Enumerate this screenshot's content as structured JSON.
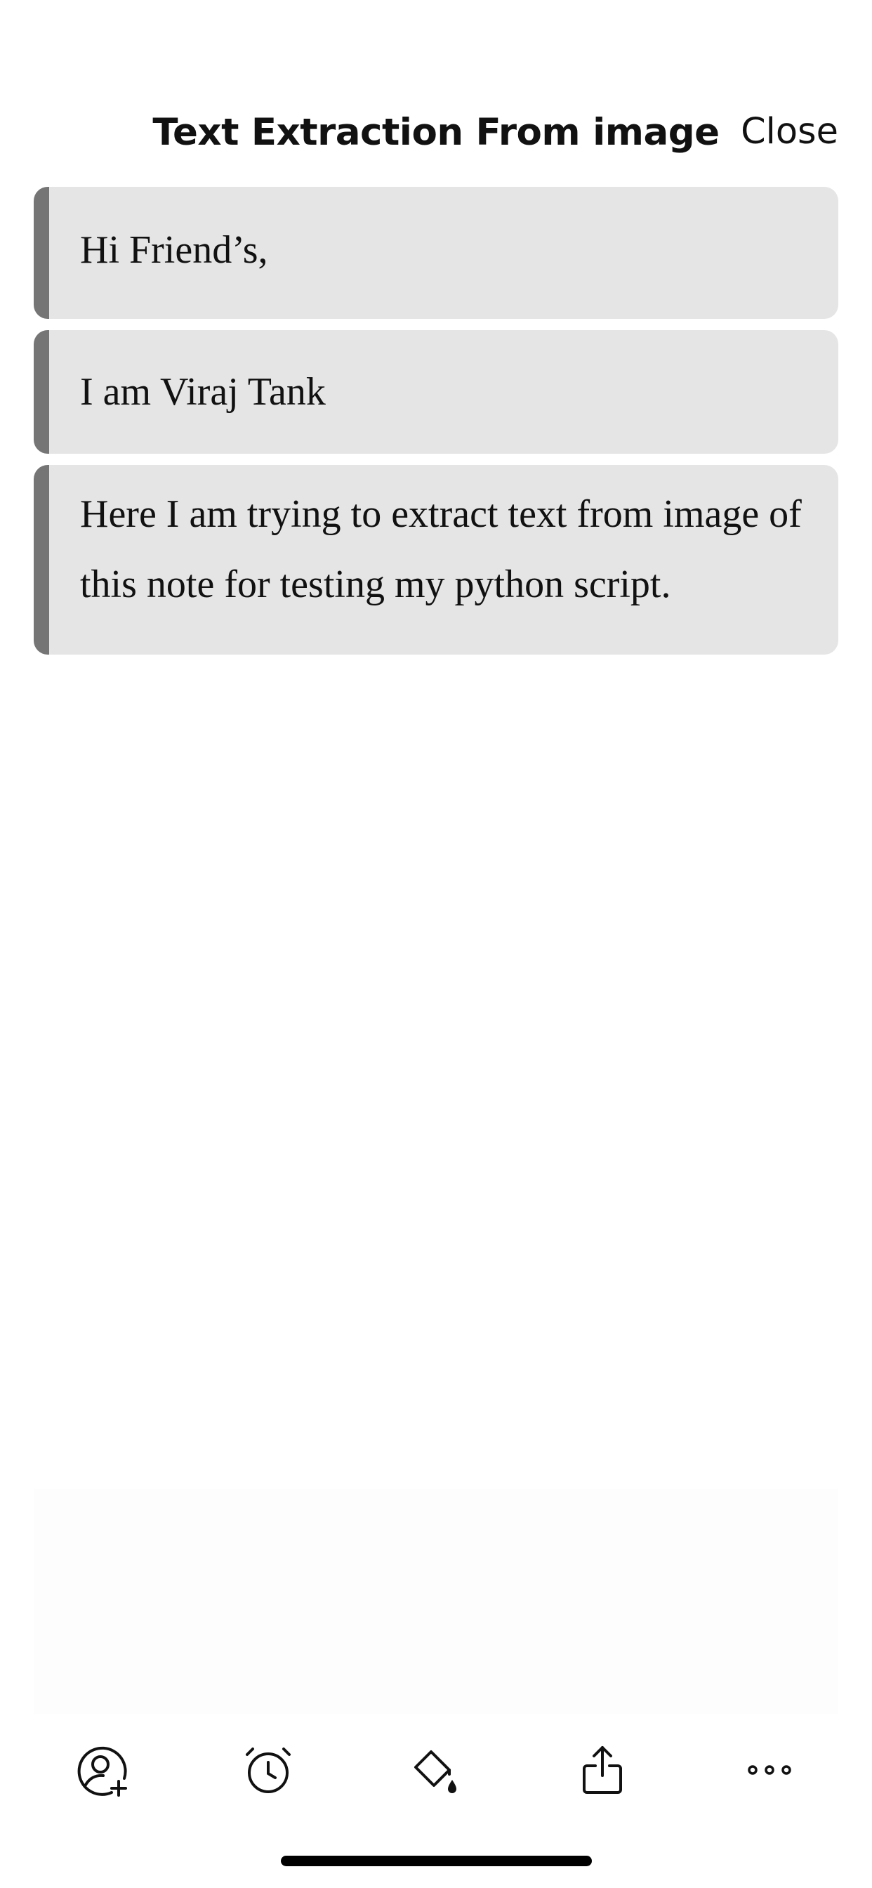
{
  "header": {
    "title": "Text Extraction From image",
    "close_label": "Close"
  },
  "blocks": [
    {
      "text": "Hi Friend’s,"
    },
    {
      "text": "I am Viraj Tank"
    },
    {
      "text": "Here I am trying to extract text from image of this note for testing my python script."
    }
  ],
  "toolbar": {
    "items": [
      {
        "icon": "add-collaborator-icon"
      },
      {
        "icon": "alarm-clock-icon"
      },
      {
        "icon": "paint-bucket-icon"
      },
      {
        "icon": "share-icon"
      },
      {
        "icon": "more-icon"
      }
    ]
  },
  "colors": {
    "block_background": "#e5e5e5",
    "block_accent_bar": "#757575",
    "text": "#111111"
  }
}
